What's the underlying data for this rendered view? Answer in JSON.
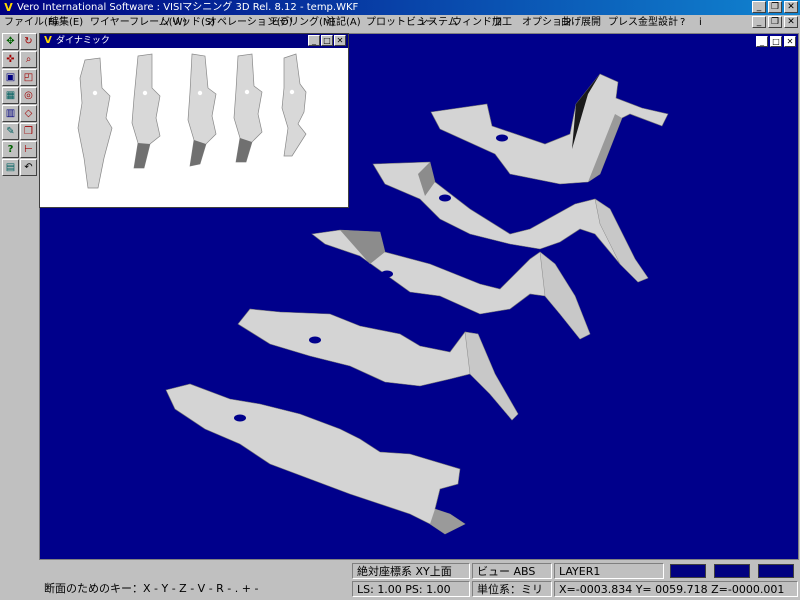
{
  "window": {
    "title": "Vero International Software : VISIマシニング 3D Rel. 8.12 - temp.WKF",
    "buttons": [
      "_",
      "❐",
      "✕"
    ]
  },
  "menu": [
    "ファイル(F)",
    "編集(E)",
    "ワイヤーフレーム(W)",
    "ソリッド(S)",
    "オペレーション(O)",
    "モデリング(M)",
    "注記(A)",
    "プロットビュー",
    "システム",
    "ウィンドウ",
    "加工",
    "オプション",
    "曲げ展開",
    "プレス金型設計",
    "?",
    "i"
  ],
  "toolbar": {
    "icons": [
      "pan-icon",
      "rotate-icon",
      "move-icon",
      "zoom-icon",
      "cube-icon",
      "corner-icon",
      "grid-icon",
      "target-icon",
      "box-icon",
      "diamond-icon",
      "paint-icon",
      "solid-icon",
      "help-icon",
      "measure-icon",
      "trash-icon",
      "undo-icon"
    ],
    "glyphs": [
      "✥",
      "↻",
      "✜",
      "⌕",
      "▣",
      "◰",
      "▦",
      "◎",
      "▥",
      "◇",
      "✎",
      "❒",
      "?",
      "⊢",
      "▤",
      "↶"
    ]
  },
  "inset": {
    "title": "ダイナミック",
    "buttons": [
      "_",
      "□",
      "✕"
    ]
  },
  "viewport": {
    "buttons": [
      "_",
      "□",
      "✕"
    ]
  },
  "status": {
    "coord_system": "絶対座標系  XY上面",
    "view": "ビュー ABS",
    "layer": "LAYER1",
    "section_keys": "断面のためのキー：X - Y - Z - V - R - . + -",
    "ls_ps": "LS: 1.00 PS: 1.00",
    "unit": "単位系：ミリ",
    "coords": "X=-0003.834 Y= 0059.718 Z=-0000.001"
  },
  "colors": {
    "viewport_bg": "#00008b",
    "part": "#d4d4d4",
    "part_shade": "#8c8c8c"
  }
}
